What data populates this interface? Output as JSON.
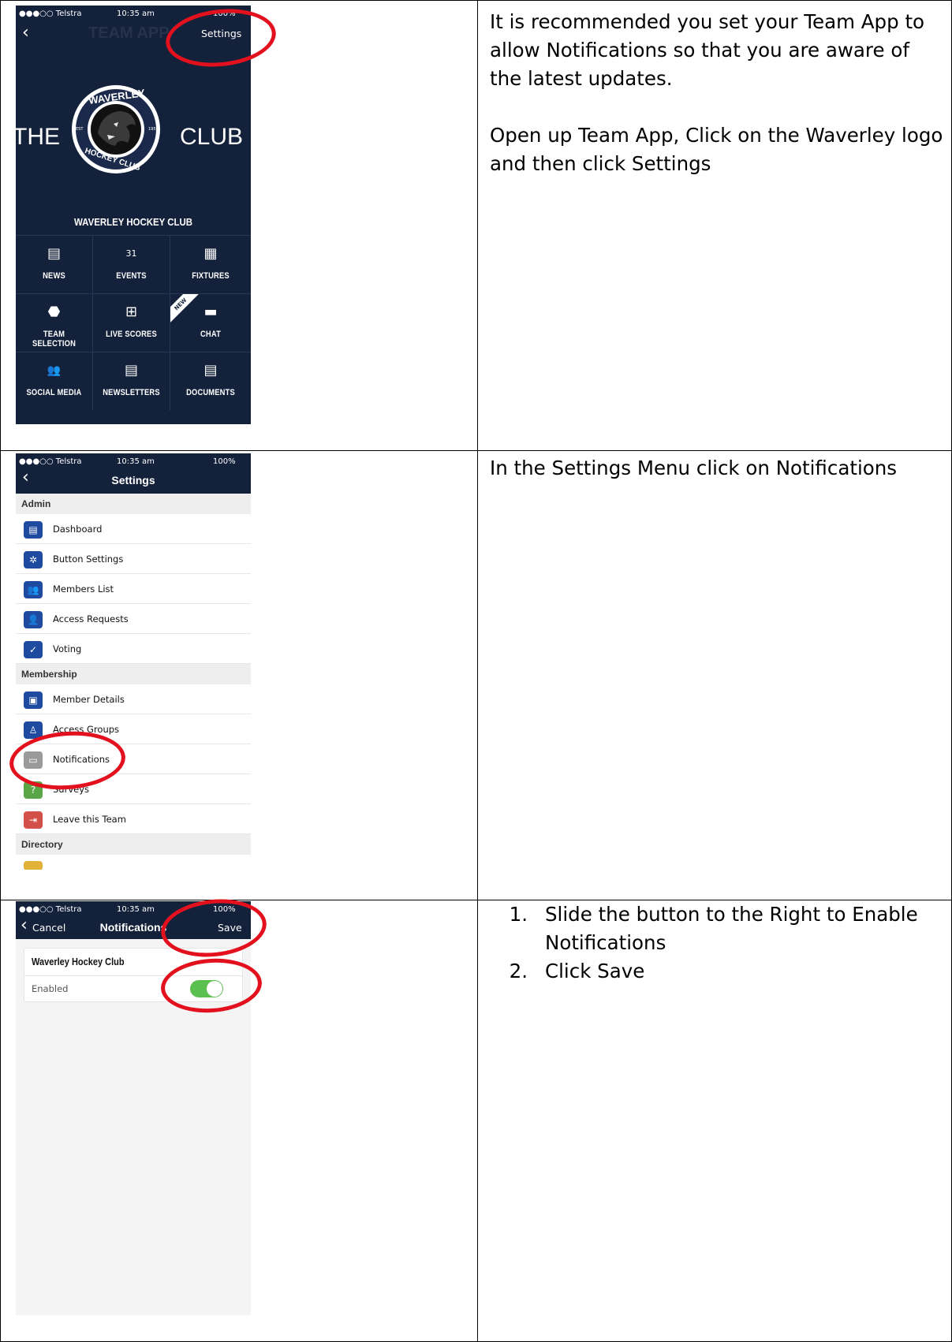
{
  "rows": [
    {
      "instructions": [
        "It is recommended you set your Team App to allow Notifications so that you are aware of the latest updates.",
        "Open up Team App, Click on the Waverley logo and then click Settings"
      ]
    },
    {
      "instructions": [
        "In the Settings Menu click on Notifications"
      ]
    },
    {
      "steps": [
        {
          "num": "1.",
          "text": "Slide the button to the Right to Enable Notifications"
        },
        {
          "num": "2.",
          "text": "Click Save"
        }
      ]
    }
  ],
  "status_bar": {
    "carrier": "●●●○○ Telstra",
    "time": "10:35 am",
    "battery": "100%"
  },
  "home": {
    "watermark": "TEAM APP",
    "settings_label": "Settings",
    "banner_left": "THE",
    "banner_right": "CLUB",
    "logo_top": "WAVERLEY",
    "logo_bottom": "HOCKEY CLUB",
    "logo_est": "EST",
    "logo_year": "1958",
    "club_name": "WAVERLEY HOCKEY CLUB",
    "new_badge": "NEW",
    "tiles": [
      {
        "label": "NEWS",
        "icon": "▤"
      },
      {
        "label": "EVENTS",
        "icon": "31"
      },
      {
        "label": "FIXTURES",
        "icon": "▦"
      },
      {
        "label": "TEAM SELECTION",
        "icon": "⬣"
      },
      {
        "label": "LIVE SCORES",
        "icon": "⊞"
      },
      {
        "label": "CHAT",
        "icon": "▬"
      },
      {
        "label": "SOCIAL MEDIA",
        "icon": "👥"
      },
      {
        "label": "NEWSLETTERS",
        "icon": "▤"
      },
      {
        "label": "DOCUMENTS",
        "icon": "▤"
      }
    ]
  },
  "settings": {
    "title": "Settings",
    "sections": [
      {
        "name": "Admin"
      },
      {
        "name": "Membership"
      },
      {
        "name": "Directory"
      }
    ],
    "admin_items": [
      {
        "label": "Dashboard",
        "color": "#1e4aa0"
      },
      {
        "label": "Button Settings",
        "color": "#1e4aa0"
      },
      {
        "label": "Members List",
        "color": "#1e4aa0"
      },
      {
        "label": "Access Requests",
        "color": "#1e4aa0"
      },
      {
        "label": "Voting",
        "color": "#1e4aa0"
      }
    ],
    "membership_items": [
      {
        "label": "Member Details",
        "color": "#1e4aa0"
      },
      {
        "label": "Access Groups",
        "color": "#1e4aa0"
      },
      {
        "label": "Notifications",
        "color": "#9a9a9a"
      },
      {
        "label": "Surveys",
        "color": "#5aa646"
      },
      {
        "label": "Leave this Team",
        "color": "#d24f4a"
      }
    ]
  },
  "notifications": {
    "cancel": "Cancel",
    "title": "Notifications",
    "save": "Save",
    "club": "Waverley Hockey Club",
    "enabled_label": "Enabled",
    "enabled": true,
    "toggle_color": "#5ac151"
  },
  "colors": {
    "navy": "#14213b",
    "highlight": "#e2111d"
  }
}
